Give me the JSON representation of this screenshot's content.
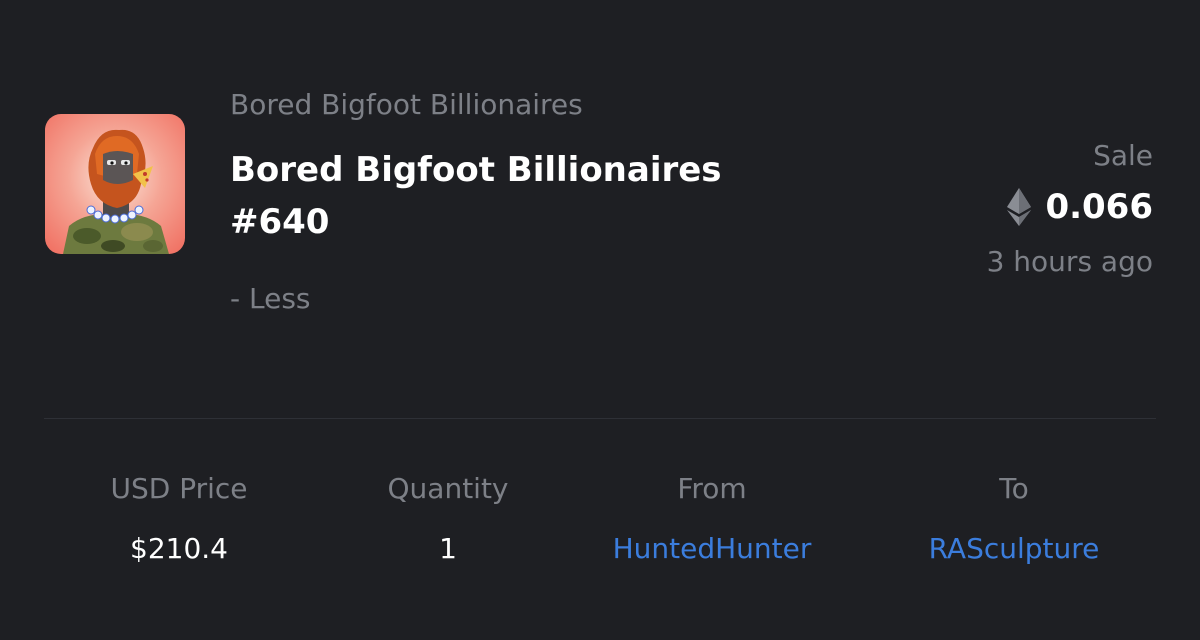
{
  "item": {
    "collection": "Bored Bigfoot Billionaires",
    "title": "Bored Bigfoot Billionaires #640",
    "less_label": "- Less",
    "image_icon": "bigfoot-nft-thumbnail"
  },
  "sale": {
    "event_type": "Sale",
    "price": "0.066",
    "currency_icon": "ethereum-icon",
    "time_ago": "3 hours ago"
  },
  "stats": {
    "usd_price_label": "USD Price",
    "usd_price_value": "$210.4",
    "quantity_label": "Quantity",
    "quantity_value": "1",
    "from_label": "From",
    "from_value": "HuntedHunter",
    "to_label": "To",
    "to_value": "RASculpture"
  },
  "colors": {
    "background": "#1e1f23",
    "muted_text": "#7d8087",
    "link": "#3b7ddd",
    "divider": "#2e3036"
  }
}
